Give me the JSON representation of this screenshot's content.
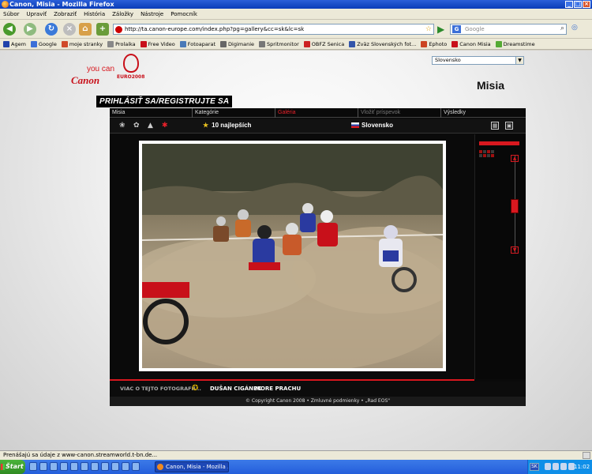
{
  "window": {
    "title": "Canon, Misia - Mozilla Firefox"
  },
  "menu": [
    "Súbor",
    "Upraviť",
    "Zobraziť",
    "História",
    "Záložky",
    "Nástroje",
    "Pomocník"
  ],
  "address": {
    "url": "http://ta.canon-europe.com/index.php?pg=gallery&cc=sk&lc=sk"
  },
  "search": {
    "placeholder": "Google"
  },
  "bookmarks": [
    {
      "label": "Agem",
      "color": "#2244aa"
    },
    {
      "label": "Google",
      "color": "#3b6fd8"
    },
    {
      "label": "moje stranky",
      "color": "#d04a2a"
    },
    {
      "label": "Prolaika",
      "color": "#888888"
    },
    {
      "label": "Free Video",
      "color": "#c8101a"
    },
    {
      "label": "Fotoaparat",
      "color": "#4a7ab8"
    },
    {
      "label": "Digimanie",
      "color": "#666666"
    },
    {
      "label": "Spritmonitor",
      "color": "#777777"
    },
    {
      "label": "OBFZ Senica",
      "color": "#cc2222"
    },
    {
      "label": "Zväz Slovenských fot...",
      "color": "#3355aa"
    },
    {
      "label": "Ephoto",
      "color": "#cc4422"
    },
    {
      "label": "Canon Misia",
      "color": "#c8101a"
    },
    {
      "label": "Dreamstime",
      "color": "#55aa33"
    }
  ],
  "brand": {
    "youcan": "you can",
    "canon": "Canon",
    "euro": "EURO2008",
    "misia": "Misia"
  },
  "language_select": {
    "value": "Slovensko"
  },
  "login_banner": "PRIHLÁSIŤ SA/REGISTRUJTE SA",
  "tabs": [
    {
      "label": "Misia",
      "state": "normal"
    },
    {
      "label": "Kategórie",
      "state": "normal"
    },
    {
      "label": "Galéria",
      "state": "active"
    },
    {
      "label": "Vložiť príspevok",
      "state": "disabled"
    },
    {
      "label": "Výsledky",
      "state": "normal"
    }
  ],
  "subbar": {
    "top_label": "10 najlepších",
    "country": "Slovensko"
  },
  "photo_info": {
    "about": "VIAC O TEJTO FOTOGRAFII...",
    "author": "DUŠAN CIGÁNEK",
    "title": "MORE PRACHU"
  },
  "footer": {
    "copyright": "© Copyright Canon 2008 • Zmluvné podmienky • „Rad EOS\""
  },
  "status": {
    "text": "Prenášajú sa údaje z www-canon.streamworld.t-bn.de..."
  },
  "taskbar": {
    "start": "Štart",
    "task": "Canon, Misia - Mozilla ...",
    "lang": "SK",
    "clock": "11:02"
  },
  "icons": [
    "firefox-icon",
    "back-icon",
    "forward-icon",
    "reload-icon",
    "stop-icon",
    "home-icon",
    "new-tab-icon",
    "go-icon",
    "search-icon",
    "star-icon",
    "flag-icon",
    "grid-view-icon",
    "fullscreen-icon",
    "award-icon"
  ]
}
